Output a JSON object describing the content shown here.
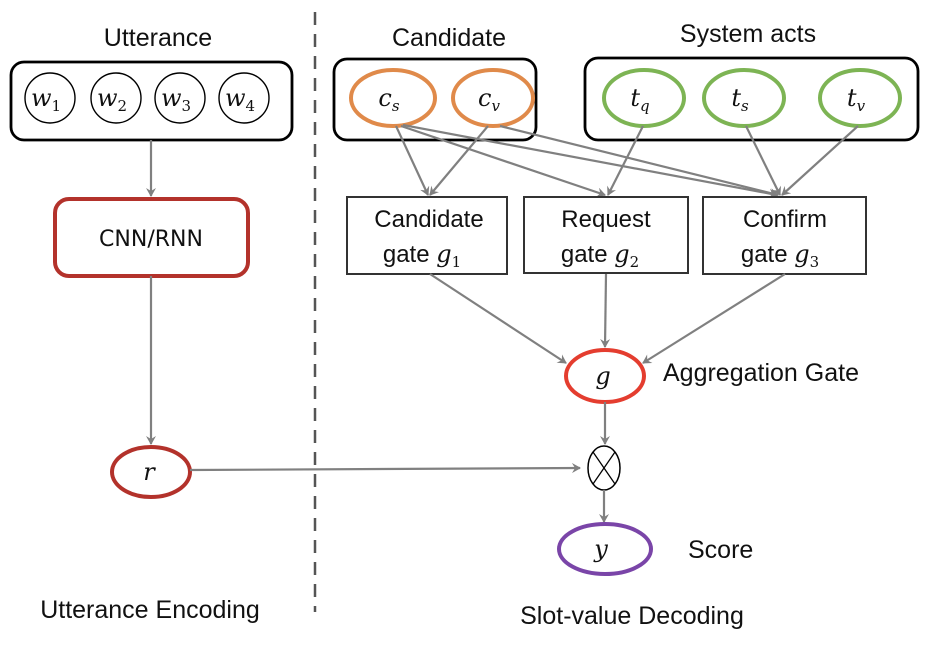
{
  "headings": {
    "utterance": "Utterance",
    "candidate": "Candidate",
    "system_acts": "System acts",
    "utterance_encoding": "Utterance Encoding",
    "slot_value_decoding": "Slot-value Decoding"
  },
  "words": [
    {
      "base": "w",
      "sub": "1"
    },
    {
      "base": "w",
      "sub": "2"
    },
    {
      "base": "w",
      "sub": "3"
    },
    {
      "base": "w",
      "sub": "4"
    }
  ],
  "encoder": "CNN/RNN",
  "representation": "r",
  "candidate_nodes": [
    {
      "base": "c",
      "sub": "s"
    },
    {
      "base": "c",
      "sub": "v"
    }
  ],
  "system_act_nodes": [
    {
      "base": "t",
      "sub": "q"
    },
    {
      "base": "t",
      "sub": "s"
    },
    {
      "base": "t",
      "sub": "v"
    }
  ],
  "gates": [
    {
      "line1": "Candidate",
      "line2": "gate",
      "var": "g",
      "sub": "1"
    },
    {
      "line1": "Request",
      "line2": "gate",
      "var": "g",
      "sub": "2"
    },
    {
      "line1": "Confirm",
      "line2": "gate",
      "var": "g",
      "sub": "3"
    }
  ],
  "aggregation": {
    "var": "g",
    "label": "Aggregation Gate"
  },
  "output": {
    "var": "y",
    "label": "Score"
  },
  "colors": {
    "encoder": "#b3322b",
    "candidate": "#e08a4a",
    "system_acts": "#7db454",
    "aggregation": "#e43d2f",
    "output": "#7a45a8",
    "edge": "#808080"
  }
}
